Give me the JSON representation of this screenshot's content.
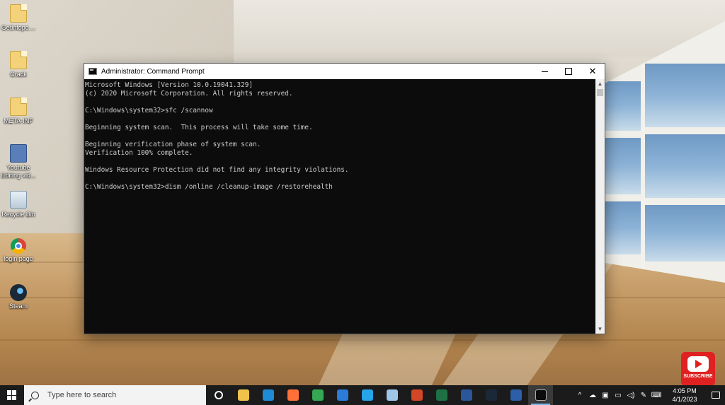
{
  "desktop": {
    "icons": [
      {
        "label": "Getintopc....",
        "name": "desktop-icon-getintopc",
        "icon": "file-icon"
      },
      {
        "label": "Crack",
        "name": "desktop-icon-crack",
        "icon": "file-icon"
      },
      {
        "label": "META-INF",
        "name": "desktop-icon-meta-inf",
        "icon": "file-icon"
      },
      {
        "label": "Youtube Editing vid...",
        "name": "desktop-icon-youtube-editing",
        "icon": "video-file-icon"
      },
      {
        "label": "Recycle Bin",
        "name": "desktop-icon-recycle-bin",
        "icon": "recycle-bin-icon"
      },
      {
        "label": "login page",
        "name": "desktop-icon-login-page",
        "icon": "chrome-icon"
      },
      {
        "label": "Steam",
        "name": "desktop-icon-steam",
        "icon": "steam-icon"
      }
    ]
  },
  "cmd": {
    "title": "Administrator: Command Prompt",
    "minimize_label": "",
    "maximize_label": "",
    "close_label": "✕",
    "lines": [
      "Microsoft Windows [Version 10.0.19041.329]",
      "(c) 2020 Microsoft Corporation. All rights reserved.",
      "",
      "C:\\Windows\\system32>sfc /scannow",
      "",
      "Beginning system scan.  This process will take some time.",
      "",
      "Beginning verification phase of system scan.",
      "Verification 100% complete.",
      "",
      "Windows Resource Protection did not find any integrity violations.",
      "",
      "C:\\Windows\\system32>dism /online /cleanup-image /restorehealth"
    ]
  },
  "subscribe": {
    "label": "SUBSCRIBE"
  },
  "taskbar": {
    "search_placeholder": "Type here to search",
    "apps": [
      {
        "name": "taskbar-file-explorer",
        "icon": "folder-icon",
        "color": "#f0c24b"
      },
      {
        "name": "taskbar-edge",
        "icon": "edge-icon",
        "color": "#1f8ad6"
      },
      {
        "name": "taskbar-firefox",
        "icon": "firefox-icon",
        "color": "#ff7139"
      },
      {
        "name": "taskbar-chrome",
        "icon": "chrome-icon",
        "color": "#34a853"
      },
      {
        "name": "taskbar-app-5",
        "icon": "app-icon",
        "color": "#2b7bd8"
      },
      {
        "name": "taskbar-app-6",
        "icon": "app-icon",
        "color": "#27a3e8"
      },
      {
        "name": "taskbar-notepad",
        "icon": "notepad-icon",
        "color": "#9fc5e8"
      },
      {
        "name": "taskbar-powerpoint",
        "icon": "powerpoint-icon",
        "color": "#d24726"
      },
      {
        "name": "taskbar-excel",
        "icon": "excel-icon",
        "color": "#1e7145"
      },
      {
        "name": "taskbar-word",
        "icon": "word-icon",
        "color": "#2b579a"
      },
      {
        "name": "taskbar-steam",
        "icon": "steam-icon",
        "color": "#1b2838"
      },
      {
        "name": "taskbar-powershell",
        "icon": "powershell-icon",
        "color": "#2d5fa8"
      },
      {
        "name": "taskbar-command-prompt",
        "icon": "command-prompt-icon",
        "color": "#0c0c0c",
        "active": true
      }
    ],
    "tray": {
      "chevron": "^",
      "time": "4:05 PM",
      "date": "4/1/2023"
    }
  }
}
